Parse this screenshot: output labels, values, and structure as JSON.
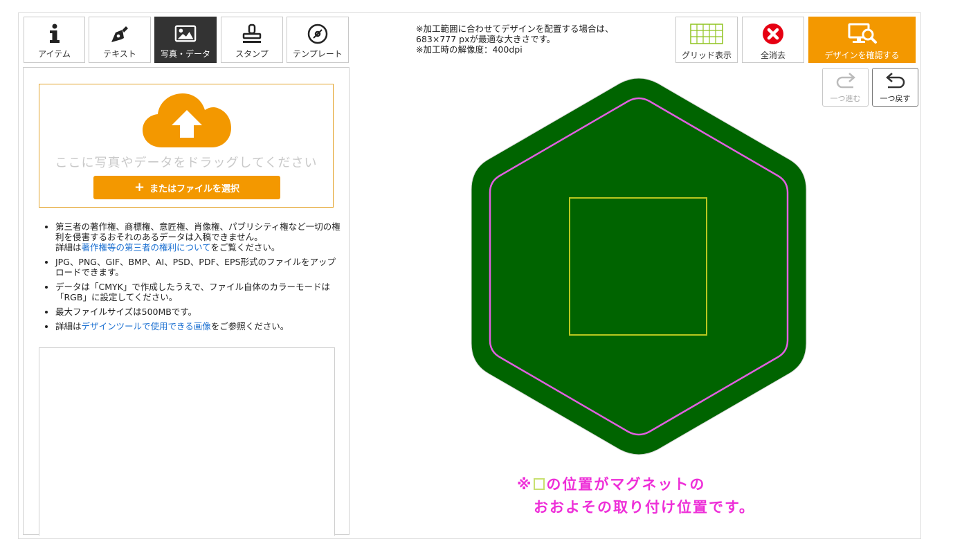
{
  "tabs": [
    {
      "label": "アイテム",
      "icon": "info-icon"
    },
    {
      "label": "テキスト",
      "icon": "pen-nib-icon"
    },
    {
      "label": "写真・データ",
      "icon": "image-icon",
      "active": true
    },
    {
      "label": "スタンプ",
      "icon": "stamp-icon"
    },
    {
      "label": "テンプレート",
      "icon": "disc-icon"
    }
  ],
  "upload": {
    "drop_text": "ここに写真やデータをドラッグしてください",
    "file_button": "またはファイルを選択"
  },
  "notes": {
    "n1_text": "第三者の著作権、商標権、意匠権、肖像権、パブリシティ権など一切の権利を侵害するおそれのあるデータは入稿できません。",
    "n1_prefix": "詳細は",
    "n1_link": "著作権等の第三者の権利について",
    "n1_suffix": "をご覧ください。",
    "n2": "JPG、PNG、GIF、BMP、AI、PSD、PDF、EPS形式のファイルをアップロードできます。",
    "n3": "データは「CMYK」で作成したうえで、ファイル自体のカラーモードは「RGB」に設定してください。",
    "n4": "最大ファイルサイズは500MBです。",
    "n5_prefix": "詳細は",
    "n5_link": "デザインツールで使用できる画像",
    "n5_suffix": "をご参照ください。"
  },
  "info": {
    "line1": "※加工範囲に合わせてデザインを配置する場合は、",
    "line2": "683×777 pxが最適な大きさです。",
    "line3": "※加工時の解像度：400dpi"
  },
  "toolbar": {
    "grid_label": "グリッド表示",
    "clear_label": "全消去",
    "confirm_label": "デザインを確認する",
    "redo_label": "一つ進む",
    "undo_label": "一つ戻す"
  },
  "notice": {
    "prefix": "※",
    "line1_rest": "の位置がマグネットの",
    "line2": "おおよその取り付け位置です。"
  },
  "colors": {
    "accent": "#f39800",
    "canvas_fill": "#006400",
    "safe_line": "#e060e0",
    "magnet_box": "#b8c820",
    "notice": "#ee2fd8"
  }
}
